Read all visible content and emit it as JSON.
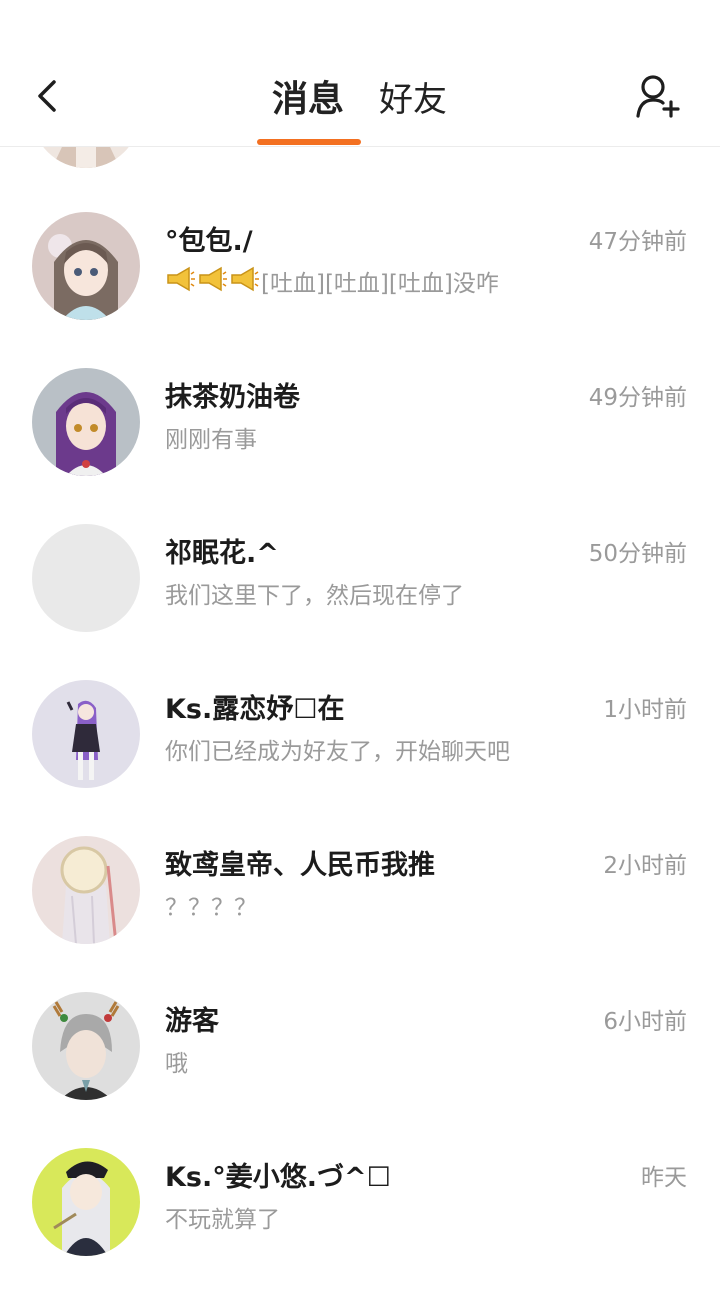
{
  "header": {
    "tabs": [
      {
        "label": "消息",
        "active": true
      },
      {
        "label": "好友",
        "active": false
      }
    ],
    "accent_color": "#f37021"
  },
  "conversations": [
    {
      "name": "°包包./",
      "time": "47分钟前",
      "preview_icons": [
        "megaphone-emoji",
        "megaphone-emoji",
        "megaphone-emoji"
      ],
      "preview": "[吐血][吐血][吐血]没咋"
    },
    {
      "name": "抹茶奶油卷",
      "time": "49分钟前",
      "preview": "刚刚有事"
    },
    {
      "name": "祁眠花.^",
      "time": "50分钟前",
      "preview": "我们这里下了，然后现在停了"
    },
    {
      "name": "Ks.露恋妤☐在",
      "time": "1小时前",
      "preview": "你们已经成为好友了，开始聊天吧"
    },
    {
      "name": "致鸢皇帝、人民币我推",
      "time": "2小时前",
      "preview": "？？？？"
    },
    {
      "name": "游客",
      "time": "6小时前",
      "preview": "哦"
    },
    {
      "name": "Ks.°姜小悠.づ^☐",
      "time": "昨天",
      "preview": "不玩就算了"
    }
  ]
}
